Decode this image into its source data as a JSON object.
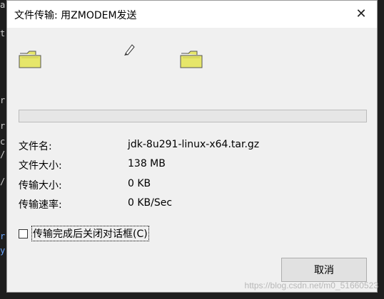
{
  "dialog": {
    "title": "文件传输: 用ZMODEM发送",
    "close_glyph": "✕"
  },
  "progress": {
    "fraction": 0
  },
  "info": [
    {
      "label": "文件名:",
      "value": "jdk-8u291-linux-x64.tar.gz"
    },
    {
      "label": "文件大小:",
      "value": "138 MB"
    },
    {
      "label": "传输大小:",
      "value": "0 KB"
    },
    {
      "label": "传输速率:",
      "value": "0 KB/Sec"
    }
  ],
  "checkbox": {
    "label": "传输完成后关闭对话框(C)",
    "checked": false
  },
  "cancel_label": "取消",
  "watermark": "https://blog.csdn.net/m0_51660523",
  "terminal_fragments": [
    "a",
    "t",
    "r,",
    "r,",
    "c",
    "/",
    "/",
    "r",
    "y"
  ],
  "colors": {
    "folder": "#e6e66a",
    "progress": "#06b025"
  }
}
